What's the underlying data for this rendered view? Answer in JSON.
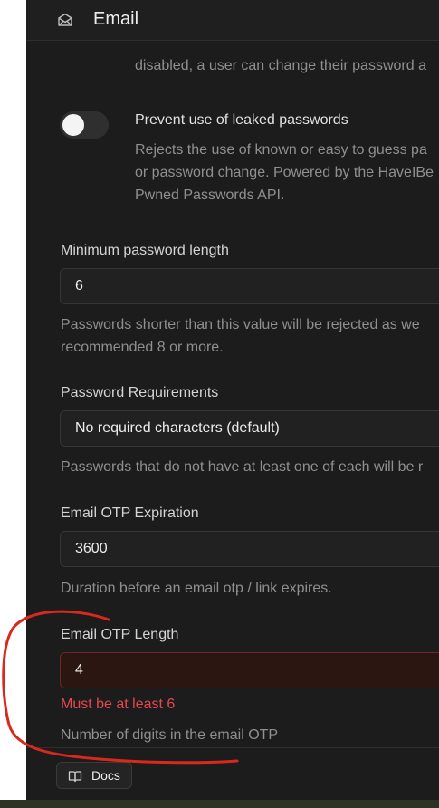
{
  "header": {
    "title": "Email",
    "icon": "envelope-open-icon"
  },
  "truncated_desc": "disabled, a user can change their password a",
  "leaked_passwords": {
    "label": "Prevent use of leaked passwords",
    "toggle_state": "off",
    "desc_lines": [
      "Rejects the use of known or easy to guess pa",
      "or password change. Powered by the HaveIBe",
      "Pwned Passwords API."
    ]
  },
  "min_password_length": {
    "label": "Minimum password length",
    "value": "6",
    "help_lines": [
      "Passwords shorter than this value will be rejected as we",
      "recommended 8 or more."
    ]
  },
  "password_requirements": {
    "label": "Password Requirements",
    "value": "No required characters (default)",
    "help": "Passwords that do not have at least one of each will be r"
  },
  "otp_expiration": {
    "label": "Email OTP Expiration",
    "value": "3600",
    "help": "Duration before an email otp / link expires."
  },
  "otp_length": {
    "label": "Email OTP Length",
    "value": "4",
    "error": "Must be at least 6",
    "help": "Number of digits in the email OTP"
  },
  "footer": {
    "docs_label": "Docs",
    "docs_icon": "book-open-icon"
  },
  "colors": {
    "panel_bg": "#1c1c1c",
    "error_red": "#e5484d",
    "annotation_red": "#d9281c"
  }
}
